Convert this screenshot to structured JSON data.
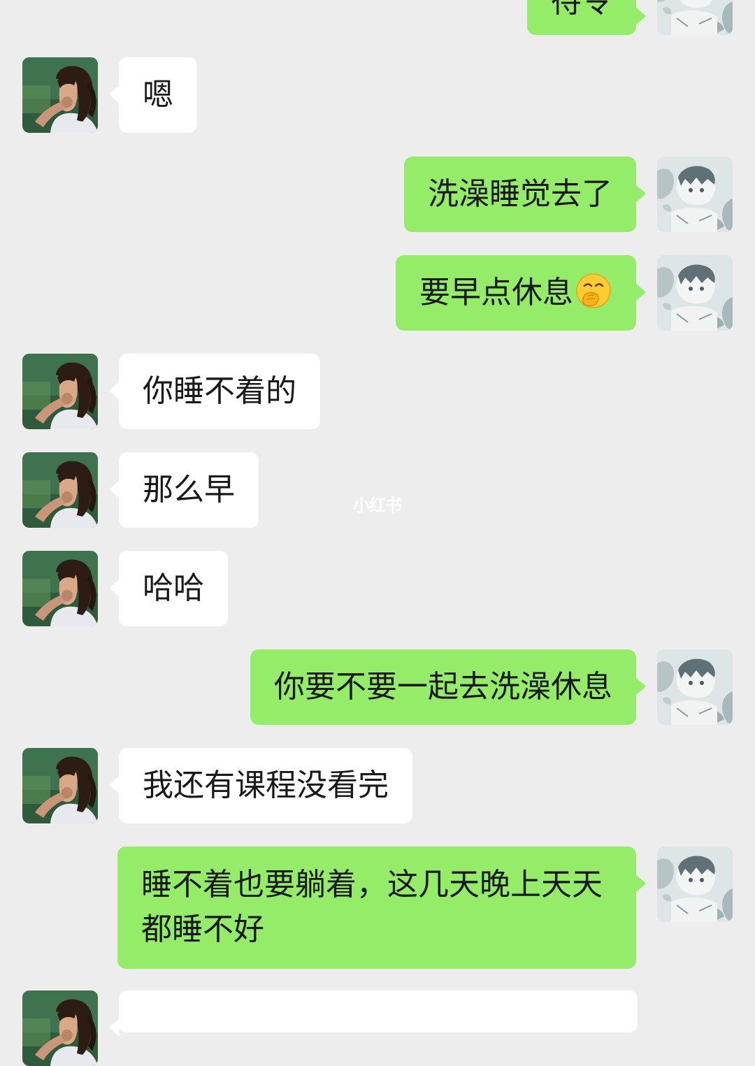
{
  "chat": {
    "messages": [
      {
        "side": "out",
        "text": "待令",
        "partial": true
      },
      {
        "side": "in",
        "text": "嗯"
      },
      {
        "side": "out",
        "text": "洗澡睡觉去了"
      },
      {
        "side": "out",
        "text": "要早点休息",
        "emoji": "hand-over-mouth-emoji"
      },
      {
        "side": "in",
        "text": "你睡不着的"
      },
      {
        "side": "in",
        "text": "那么早"
      },
      {
        "side": "in",
        "text": "哈哈"
      },
      {
        "side": "out",
        "text": "你要不要一起去洗澡休息"
      },
      {
        "side": "in",
        "text": "我还有课程没看完"
      },
      {
        "side": "out",
        "text": "睡不着也要躺着，这几天晚上天天都睡不好"
      },
      {
        "side": "in",
        "text": "",
        "partial": true
      }
    ]
  },
  "watermark": "小红书",
  "colors": {
    "background": "#ededed",
    "incoming_bubble": "#ffffff",
    "outgoing_bubble": "#95ec69"
  },
  "icons": {
    "self_avatar": "anime-boy-avatar",
    "contact_avatar": "girl-photo-avatar"
  }
}
